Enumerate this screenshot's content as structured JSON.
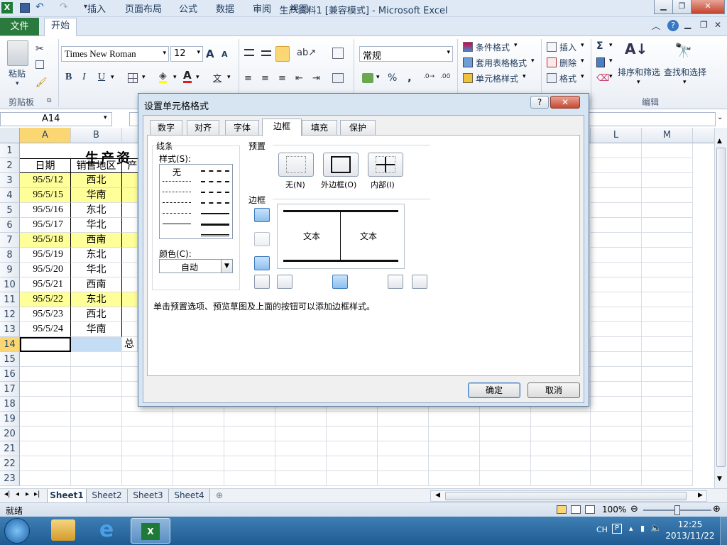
{
  "window": {
    "title": "生产资料1  [兼容模式] - Microsoft Excel"
  },
  "ribbon": {
    "tabs": [
      "文件",
      "开始",
      "插入",
      "页面布局",
      "公式",
      "数据",
      "审阅",
      "视图"
    ],
    "font_name": "Times New Roman",
    "font_size": "12",
    "number_format": "常规",
    "paste_label": "粘贴",
    "clipboard_label": "剪贴板",
    "cond_format": "条件格式",
    "table_format": "套用表格格式",
    "cell_style": "单元格样式",
    "insert": "插入",
    "delete": "删除",
    "format": "格式",
    "sort_filter": "排序和筛选",
    "find_select": "查找和选择",
    "edit_label": "编辑",
    "sigma": "Σ",
    "percent": "%",
    "comma": ",",
    "bold": "B",
    "italic": "I",
    "underline": "U",
    "font_grow": "A",
    "font_shrink": "A"
  },
  "formula_bar": {
    "name_box": "A14"
  },
  "grid": {
    "columns": [
      "A",
      "B",
      "",
      "L",
      "M"
    ],
    "rows": [
      "1",
      "2",
      "3",
      "4",
      "5",
      "6",
      "7",
      "8",
      "9",
      "10",
      "11",
      "12",
      "13",
      "14",
      "15",
      "16",
      "17",
      "18",
      "19",
      "20",
      "21",
      "22",
      "23"
    ],
    "title_text": "生产资",
    "header_row": [
      "日期",
      "销售地区",
      "产"
    ],
    "data": [
      {
        "date": "95/5/12",
        "region": "西北",
        "hl": true
      },
      {
        "date": "95/5/15",
        "region": "华南",
        "hl": true
      },
      {
        "date": "95/5/16",
        "region": "东北",
        "hl": false
      },
      {
        "date": "95/5/17",
        "region": "华北",
        "hl": false
      },
      {
        "date": "95/5/18",
        "region": "西南",
        "hl": true
      },
      {
        "date": "95/5/19",
        "region": "东北",
        "hl": false
      },
      {
        "date": "95/5/20",
        "region": "华北",
        "hl": false
      },
      {
        "date": "95/5/21",
        "region": "西南",
        "hl": false
      },
      {
        "date": "95/5/22",
        "region": "东北",
        "hl": true
      },
      {
        "date": "95/5/23",
        "region": "西北",
        "hl": false
      },
      {
        "date": "95/5/24",
        "region": "华南",
        "hl": false
      }
    ],
    "total_text": "总"
  },
  "sheets": [
    "Sheet1",
    "Sheet2",
    "Sheet3",
    "Sheet4"
  ],
  "status": {
    "ready": "就绪",
    "zoom": "100%"
  },
  "taskbar": {
    "lang": "CH",
    "time": "12:25",
    "date": "2013/11/22"
  },
  "dialog": {
    "title": "设置单元格格式",
    "help": "?",
    "tabs": [
      "数字",
      "对齐",
      "字体",
      "边框",
      "填充",
      "保护"
    ],
    "line_section": "线条",
    "style_label": "样式(S):",
    "none_style": "无",
    "color_label": "颜色(C):",
    "color_value": "自动",
    "preset_section": "预置",
    "preset_none": "无(N)",
    "preset_outline": "外边框(O)",
    "preset_inside": "内部(I)",
    "border_section": "边框",
    "preview_text1": "文本",
    "preview_text2": "文本",
    "hint": "单击预置选项、预览草图及上面的按钮可以添加边框样式。",
    "ok": "确定",
    "cancel": "取消"
  },
  "colors": {
    "accent": "#2a7a3d",
    "highlight": "#ffff99",
    "selected": "#c5dcf5"
  }
}
